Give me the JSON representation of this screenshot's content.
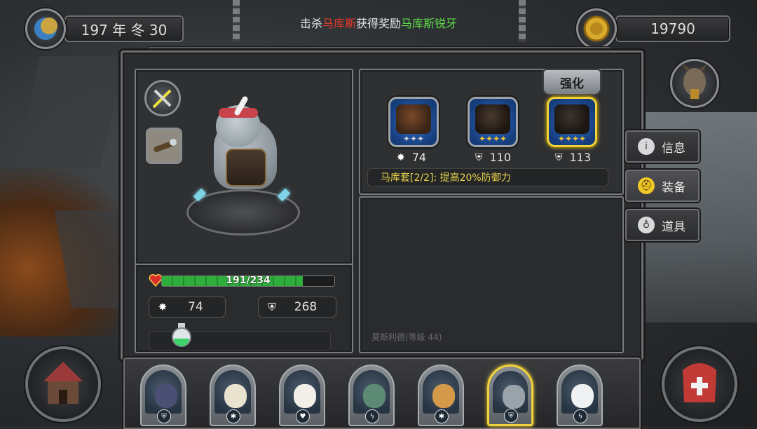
{
  "top_bar": {
    "date_text": "197 年 冬 30",
    "gold_amount": "19790",
    "kill_message": {
      "prefix": "击杀",
      "enemy": "马库斯",
      "middle": "获得奖励",
      "reward": "马库斯锐牙"
    }
  },
  "hero_panel": {
    "hp_text": "191/234",
    "hp_fraction": 0.816,
    "attack": "74",
    "defense": "268"
  },
  "equipment": {
    "enhance_label": "强化",
    "slots": [
      {
        "name": "weapon",
        "stars": 3,
        "star_color": "silver",
        "stat_icon": "attack-icon",
        "stat_value": "74",
        "selected": false
      },
      {
        "name": "armor",
        "stars": 4,
        "star_color": "gold",
        "stat_icon": "defense-icon",
        "stat_value": "110",
        "selected": false
      },
      {
        "name": "helmet",
        "stars": 4,
        "star_color": "gold",
        "stat_icon": "defense-icon",
        "stat_value": "113",
        "selected": true
      }
    ],
    "set_bonus": "马库套[2/2]: 提高20%防御力",
    "item_hint": "莫斯利德(等级 44)"
  },
  "side_tabs": [
    {
      "label": "信息",
      "icon": "info-icon",
      "active": false
    },
    {
      "label": "装备",
      "icon": "helmet-icon",
      "active": true
    },
    {
      "label": "道具",
      "icon": "potion-icon",
      "active": false
    }
  ],
  "roster": [
    {
      "hero": "boar",
      "class_icon": "shield-class-icon",
      "selected": false,
      "color": "#4b4f74"
    },
    {
      "hero": "eagle",
      "class_icon": "paw-class-icon",
      "selected": false,
      "color": "#e9e2cf"
    },
    {
      "hero": "sheep",
      "class_icon": "heart-class-icon",
      "selected": false,
      "color": "#f2efe8"
    },
    {
      "hero": "crocodile",
      "class_icon": "bolt-class-icon",
      "selected": false,
      "color": "#5d8a74"
    },
    {
      "hero": "giraffe",
      "class_icon": "paw-class-icon",
      "selected": false,
      "color": "#d49a4a"
    },
    {
      "hero": "elephant",
      "class_icon": "shield-class-icon",
      "selected": true,
      "color": "#9aa3a9"
    },
    {
      "hero": "polar-bear",
      "class_icon": "bolt-class-icon",
      "selected": false,
      "color": "#f0f1f2"
    }
  ],
  "colors": {
    "hp_green": "#2fae3c",
    "selected_gold": "#f0d23a",
    "set_bonus_yellow": "#e8d54a",
    "kill_red": "#e03a2c",
    "kill_green": "#5fdc4a"
  }
}
